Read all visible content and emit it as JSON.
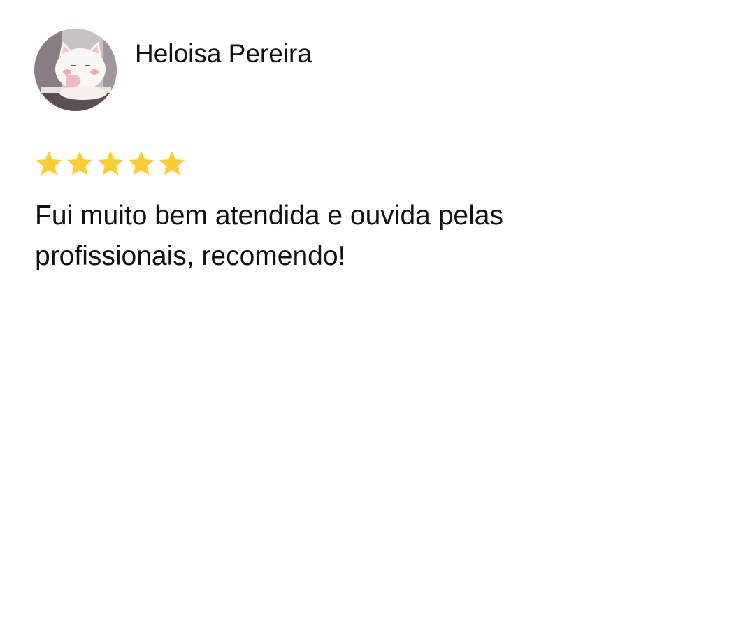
{
  "review": {
    "author": "Heloisa Pereira",
    "rating": 5,
    "rating_max": 5,
    "text": "Fui muito bem atendida e ouvida pelas profissionais, recomendo!"
  },
  "avatar": {
    "icon": "cat-avatar-icon"
  },
  "colors": {
    "star": "#FFCC33",
    "text": "#111111",
    "background": "#FFFFFF"
  }
}
